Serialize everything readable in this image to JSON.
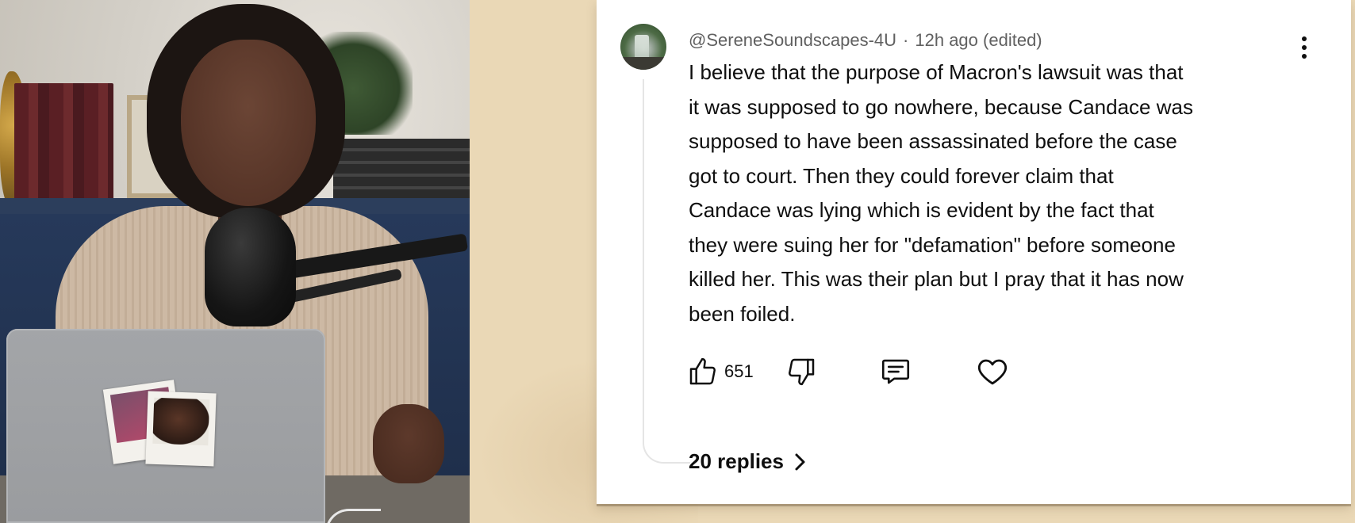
{
  "video": {
    "description_icons": [
      "microphone",
      "laptop",
      "polaroid-photos"
    ]
  },
  "comment": {
    "author": "@SereneSoundscapes-4U",
    "separator": "·",
    "time": "12h ago",
    "edited": "(edited)",
    "text": "I believe that the purpose of Macron's lawsuit was that\nit was supposed to go nowhere, because Candace was\nsupposed to have been assassinated before the case\ngot to court.  Then they could forever claim that\nCandace was lying which is evident by the fact that\nthey were suing her for \"defamation\" before someone\nkilled her.  This was their plan but I pray that it has now\nbeen foiled.",
    "like_count": "651",
    "replies_label": "20 replies",
    "icons": {
      "like": "thumbs-up-icon",
      "dislike": "thumbs-down-icon",
      "reply": "comment-icon",
      "heart": "heart-icon",
      "more": "more-vertical-icon",
      "chevron": "chevron-right-icon"
    }
  },
  "colors": {
    "backdrop": "#ead8b6",
    "card": "#ffffff",
    "text": "#0f0f0f",
    "meta": "#606060"
  }
}
